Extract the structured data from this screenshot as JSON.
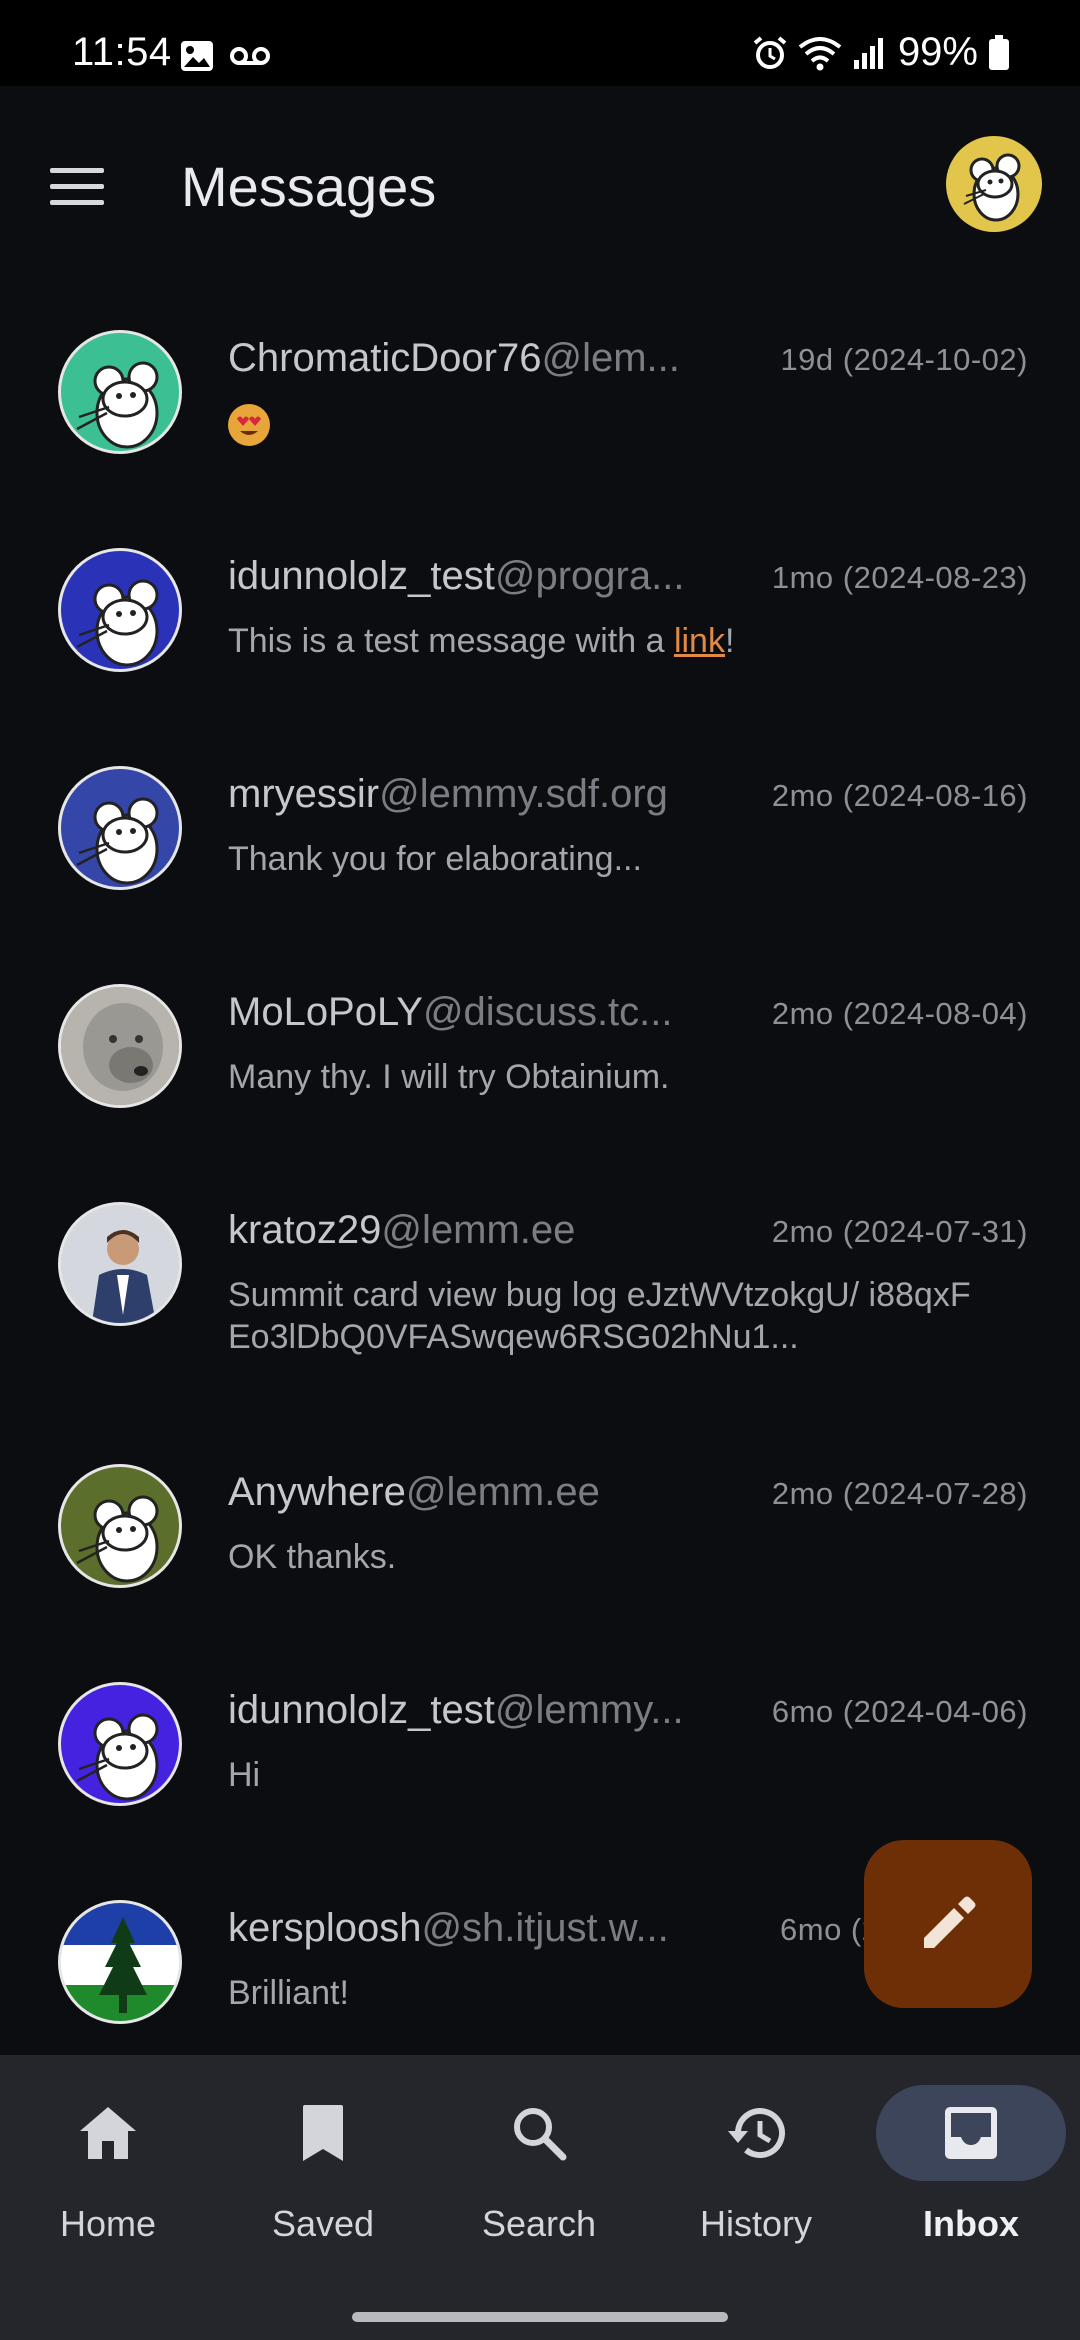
{
  "status_bar": {
    "time": "11:54",
    "battery": "99%",
    "left_icons": [
      "image-icon",
      "voicemail-icon"
    ],
    "right_icons": [
      "alarm-icon",
      "wifi-icon",
      "signal-icon",
      "battery-icon"
    ]
  },
  "app_bar": {
    "title": "Messages",
    "menu_icon": "hamburger-menu-icon",
    "profile_icon": "profile-avatar-icon"
  },
  "messages": [
    {
      "user": "ChromaticDoor76",
      "instance": "@lem...",
      "time": "19d (2024-10-02)",
      "body": "",
      "emoji": "heart-eyes-emoji",
      "avatar_color": "#3bbf93"
    },
    {
      "user": "idunnololz_test",
      "instance": "@progra...",
      "time": "1mo (2024-08-23)",
      "body_prefix": "This is a test message with a ",
      "link": "link",
      "body_suffix": "!",
      "avatar_color": "#2a33b8"
    },
    {
      "user": "mryessir",
      "instance": "@lemmy.sdf.org",
      "time": "2mo (2024-08-16)",
      "body": "Thank you for elaborating...",
      "avatar_color": "#3446a8"
    },
    {
      "user": "MoLoPoLY",
      "instance": "@discuss.tc...",
      "time": "2mo (2024-08-04)",
      "body": "Many thy. I will try Obtainium.",
      "avatar_color": "#8c8c86"
    },
    {
      "user": "kratoz29",
      "instance": "@lemm.ee",
      "time": "2mo (2024-07-31)",
      "body": "Summit card view bug log eJztWVtzokgU/ i88qxFEo3lDbQ0VFASwqew6RSG02hNu1...",
      "avatar_color": "#c8cdd4"
    },
    {
      "user": "Anywhere",
      "instance": "@lemm.ee",
      "time": "2mo (2024-07-28)",
      "body": "OK thanks.",
      "avatar_color": "#5c6e2c"
    },
    {
      "user": "idunnololz_test",
      "instance": "@lemmy...",
      "time": "6mo (2024-04-06)",
      "body": "Hi",
      "avatar_color": "#4422e0"
    },
    {
      "user": "kersploosh",
      "instance": "@sh.itjust.w...",
      "time": "6mo (2024-03-...)",
      "body": "Brilliant!",
      "avatar_color": "#1f3fa8"
    }
  ],
  "fab": {
    "icon": "pencil-icon",
    "color": "#6e2f06"
  },
  "bottom_nav": [
    {
      "label": "Home",
      "icon": "home-icon",
      "active": false
    },
    {
      "label": "Saved",
      "icon": "bookmark-icon",
      "active": false
    },
    {
      "label": "Search",
      "icon": "search-icon",
      "active": false
    },
    {
      "label": "History",
      "icon": "history-icon",
      "active": false
    },
    {
      "label": "Inbox",
      "icon": "inbox-icon",
      "active": true
    }
  ],
  "colors": {
    "background": "#0c0d10",
    "nav_background": "#24262c",
    "active_nav": "#3c4559",
    "link": "#e08a45"
  }
}
